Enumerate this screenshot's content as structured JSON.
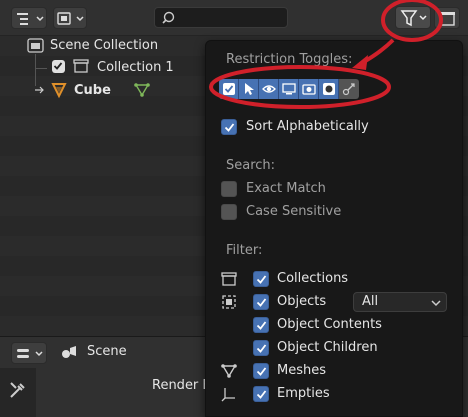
{
  "outliner": {
    "scene_collection": "Scene Collection",
    "collection_1": "Collection 1",
    "cube": "Cube"
  },
  "popover": {
    "restriction_title": "Restriction Toggles:",
    "sort_alpha": "Sort Alphabetically",
    "search_heading": "Search:",
    "exact_match": "Exact Match",
    "case_sensitive": "Case Sensitive",
    "filter_heading": "Filter:",
    "collections": "Collections",
    "objects": "Objects",
    "objects_select_value": "All",
    "object_contents": "Object Contents",
    "object_children": "Object Children",
    "meshes": "Meshes",
    "empties": "Empties"
  },
  "properties": {
    "scene_label": "Scene",
    "render_label": "Render E"
  },
  "colors": {
    "accent": "#4772b3",
    "annotation": "#d0202a",
    "mesh_icon": "#7fb85a",
    "object_icon": "#e0902a"
  }
}
